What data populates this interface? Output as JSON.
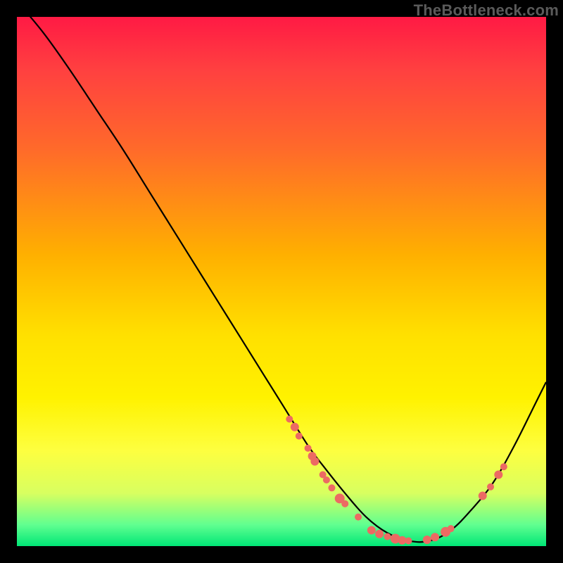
{
  "watermark": "TheBottleneck.com",
  "chart_data": {
    "type": "line",
    "title": "",
    "xlabel": "",
    "ylabel": "",
    "xlim": [
      0,
      100
    ],
    "ylim": [
      0,
      100
    ],
    "grid": false,
    "legend": false,
    "series": [
      {
        "name": "curve",
        "x": [
          0,
          5,
          10,
          15,
          20,
          25,
          30,
          35,
          40,
          45,
          50,
          55,
          58,
          62,
          66,
          70,
          74,
          78,
          82,
          86,
          90,
          94,
          98,
          100
        ],
        "values": [
          103,
          97,
          90,
          82.5,
          75,
          67,
          59,
          51,
          43,
          35,
          27,
          19,
          15,
          10,
          5.5,
          2.5,
          1,
          1,
          3,
          7,
          12,
          19,
          27,
          31
        ]
      }
    ],
    "markers": [
      {
        "x": 51.5,
        "y": 24.0,
        "r": 5
      },
      {
        "x": 52.5,
        "y": 22.5,
        "r": 6
      },
      {
        "x": 53.3,
        "y": 20.8,
        "r": 5
      },
      {
        "x": 55.0,
        "y": 18.5,
        "r": 5
      },
      {
        "x": 55.8,
        "y": 17.0,
        "r": 6
      },
      {
        "x": 56.3,
        "y": 16.0,
        "r": 6
      },
      {
        "x": 57.8,
        "y": 13.5,
        "r": 5
      },
      {
        "x": 58.5,
        "y": 12.5,
        "r": 5
      },
      {
        "x": 59.5,
        "y": 11.0,
        "r": 5
      },
      {
        "x": 61.0,
        "y": 9.0,
        "r": 7
      },
      {
        "x": 62.0,
        "y": 8.0,
        "r": 5
      },
      {
        "x": 64.5,
        "y": 5.5,
        "r": 5
      },
      {
        "x": 67.0,
        "y": 3.0,
        "r": 6
      },
      {
        "x": 68.5,
        "y": 2.3,
        "r": 6
      },
      {
        "x": 70.0,
        "y": 1.8,
        "r": 5
      },
      {
        "x": 71.5,
        "y": 1.4,
        "r": 7
      },
      {
        "x": 72.8,
        "y": 1.1,
        "r": 6
      },
      {
        "x": 74.0,
        "y": 1.0,
        "r": 5
      },
      {
        "x": 77.5,
        "y": 1.2,
        "r": 6
      },
      {
        "x": 79.0,
        "y": 1.7,
        "r": 6
      },
      {
        "x": 81.0,
        "y": 2.7,
        "r": 7
      },
      {
        "x": 82.0,
        "y": 3.3,
        "r": 5
      },
      {
        "x": 88.0,
        "y": 9.5,
        "r": 6
      },
      {
        "x": 89.5,
        "y": 11.2,
        "r": 5
      },
      {
        "x": 91.0,
        "y": 13.5,
        "r": 6
      },
      {
        "x": 92.0,
        "y": 15.0,
        "r": 5
      }
    ],
    "background": {
      "type": "vertical-gradient",
      "stops": [
        {
          "pos": 0,
          "color": "#ff1a44"
        },
        {
          "pos": 45,
          "color": "#ffb000"
        },
        {
          "pos": 72,
          "color": "#fff200"
        },
        {
          "pos": 96,
          "color": "#60ff90"
        },
        {
          "pos": 100,
          "color": "#00e676"
        }
      ]
    }
  }
}
